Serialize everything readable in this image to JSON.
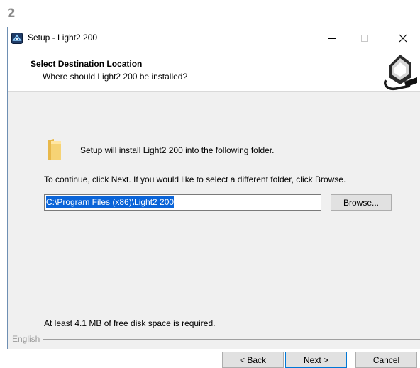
{
  "step_number": "2",
  "window": {
    "title": "Setup - Light2 200",
    "controls": {
      "minimize": "minimize",
      "maximize": "maximize",
      "close": "close"
    }
  },
  "header": {
    "title": "Select Destination Location",
    "subtitle": "Where should Light2 200 be installed?"
  },
  "body": {
    "intro": "Setup will install Light2 200 into the following folder.",
    "instruction": "To continue, click Next. If you would like to select a different folder, click Browse.",
    "path_value": "C:\\Program Files (x86)\\Light2 200",
    "browse_label": "Browse...",
    "disk_space": "At least 4.1 MB of free disk space is required."
  },
  "footer": {
    "language": "English",
    "back_label": "< Back",
    "next_label": "Next >",
    "cancel_label": "Cancel"
  },
  "colors": {
    "selection": "#0a64d8",
    "focus_border": "#0078d7",
    "dialog_bg": "#f0f0f0"
  }
}
